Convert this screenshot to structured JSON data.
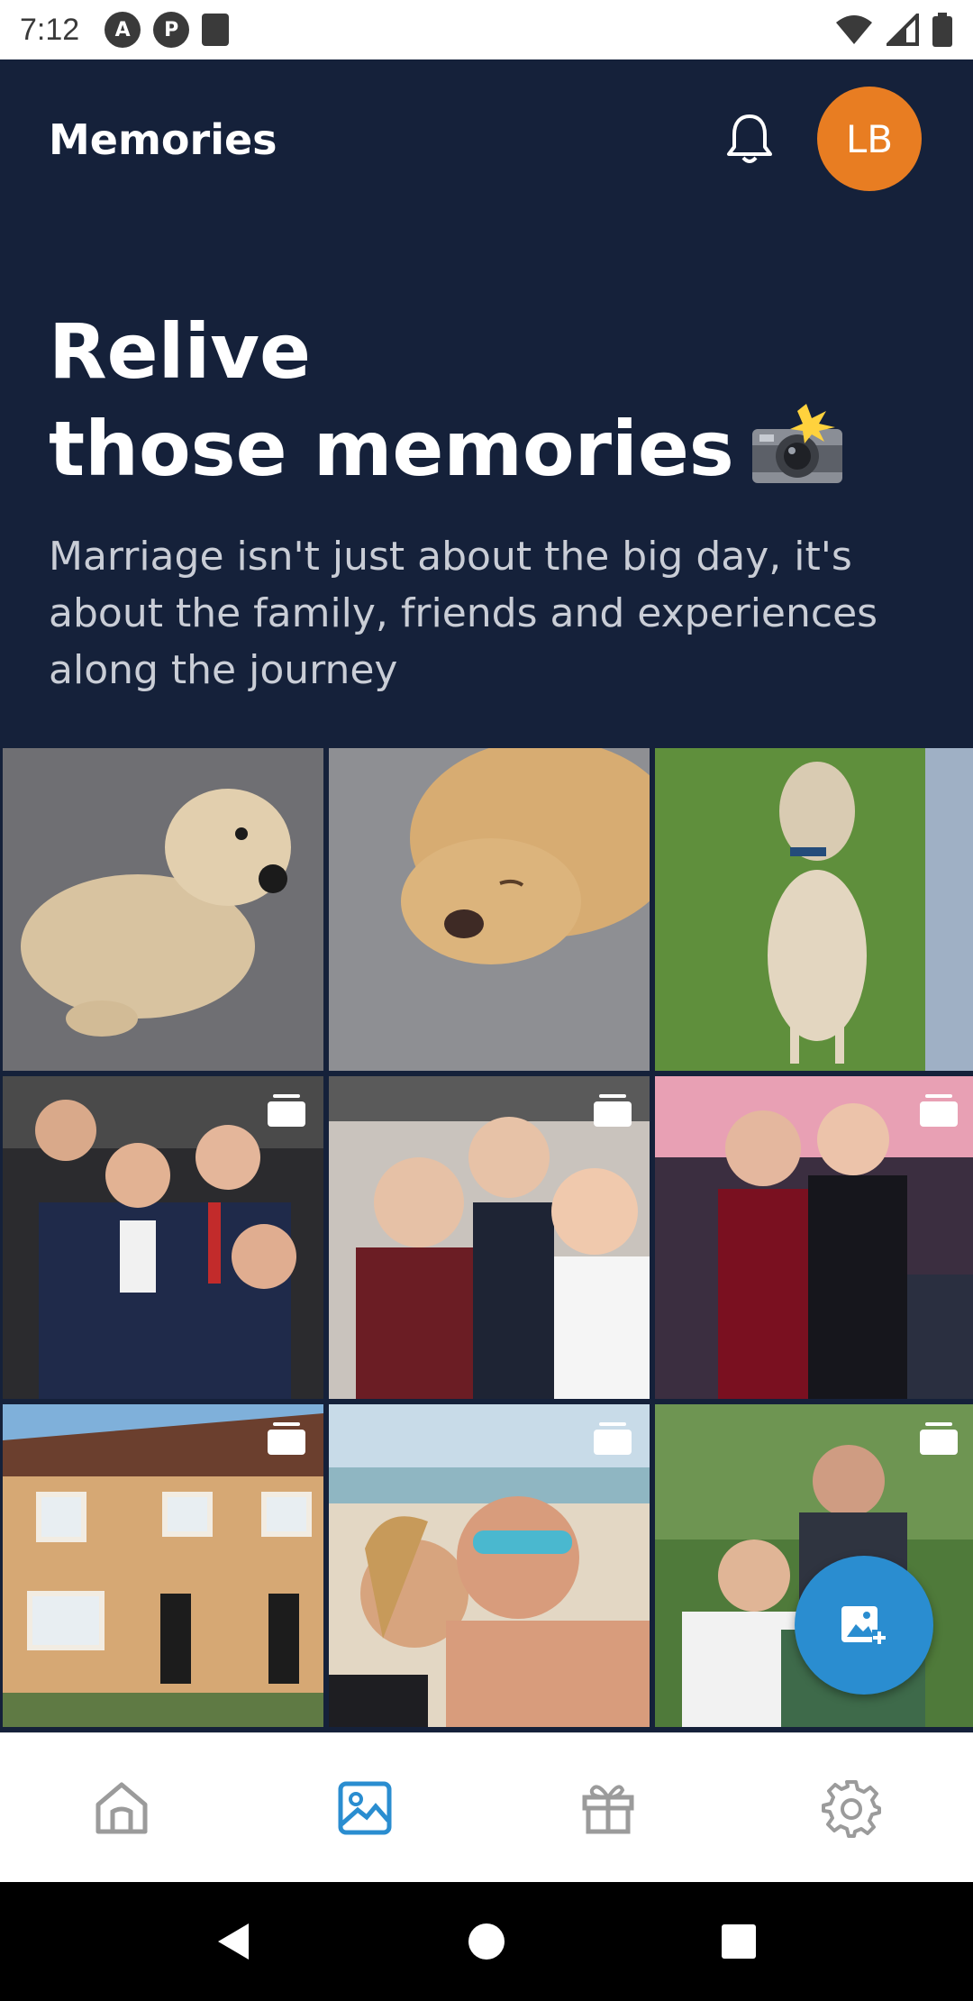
{
  "status_bar": {
    "time": "7:12",
    "left_icons": [
      "notification-a-icon",
      "notification-p-icon",
      "sd-card-icon"
    ],
    "right_icons": [
      "wifi-icon",
      "signal-icon",
      "battery-icon"
    ]
  },
  "header": {
    "title": "Memories",
    "avatar_initials": "LB",
    "avatar_color": "#e87d22",
    "background_color": "#15213a"
  },
  "hero": {
    "title_line1": "Relive",
    "title_line2": "those memories",
    "title_emoji": "camera-flash-emoji",
    "subtitle": "Marriage isn't just about the big day, it's about the family, friends and experiences along the journey"
  },
  "gallery": {
    "items": [
      {
        "subject": "dog-photo",
        "album": false
      },
      {
        "subject": "dog-photo",
        "album": false
      },
      {
        "subject": "dog-photo",
        "album": false
      },
      {
        "subject": "group-photo",
        "album": true
      },
      {
        "subject": "group-photo",
        "album": true
      },
      {
        "subject": "group-photo",
        "album": true
      },
      {
        "subject": "house-photo",
        "album": true
      },
      {
        "subject": "beach-photo",
        "album": true
      },
      {
        "subject": "outdoor-photo",
        "album": true
      }
    ]
  },
  "fab": {
    "icon": "add-photo-icon",
    "color": "#2a8dd0"
  },
  "bottom_nav": {
    "items": [
      {
        "icon": "home-icon",
        "active": false
      },
      {
        "icon": "image-icon",
        "active": true
      },
      {
        "icon": "gift-icon",
        "active": false
      },
      {
        "icon": "settings-icon",
        "active": false
      }
    ],
    "active_color": "#2a8dd0"
  },
  "system_nav": {
    "icons": [
      "back-icon",
      "home-circle-icon",
      "recents-icon"
    ]
  }
}
